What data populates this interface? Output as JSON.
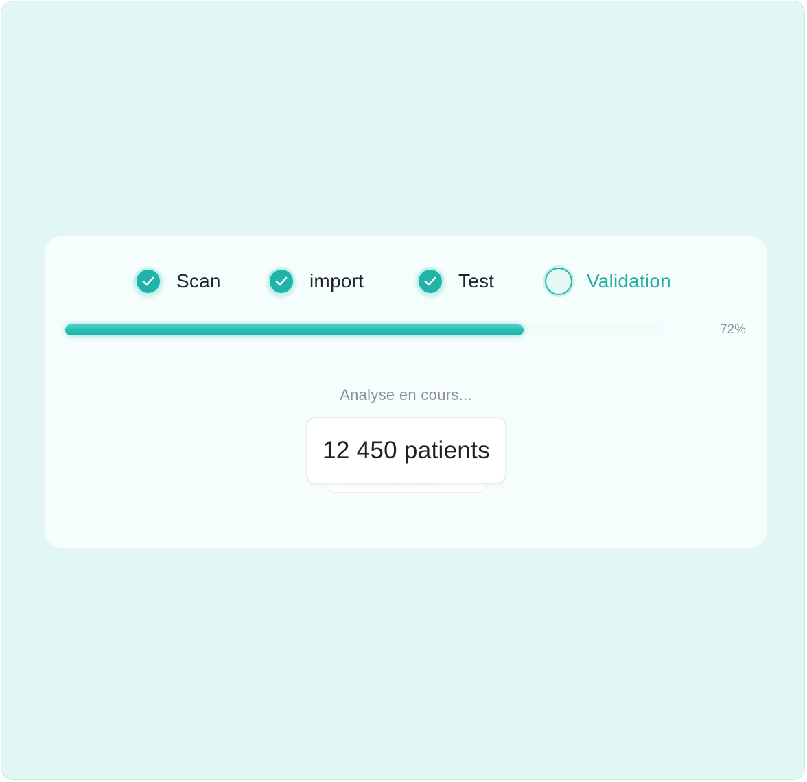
{
  "steps": [
    {
      "label": "Scan",
      "status": "done",
      "icon": "check-icon"
    },
    {
      "label": "import",
      "status": "done",
      "icon": "check-icon"
    },
    {
      "label": "Test",
      "status": "done",
      "icon": "check-icon"
    },
    {
      "label": "Validation",
      "status": "active",
      "icon": "empty-circle-icon"
    }
  ],
  "progress": {
    "value_percent": 72,
    "label": "72%"
  },
  "status_text": "Analyse en cours...",
  "counter": {
    "value": "12 450 patients"
  },
  "colors": {
    "accent": "#20b3a7",
    "active_label": "#24aca1",
    "background": "#e2f6f4",
    "card": "#f5fdfd"
  }
}
